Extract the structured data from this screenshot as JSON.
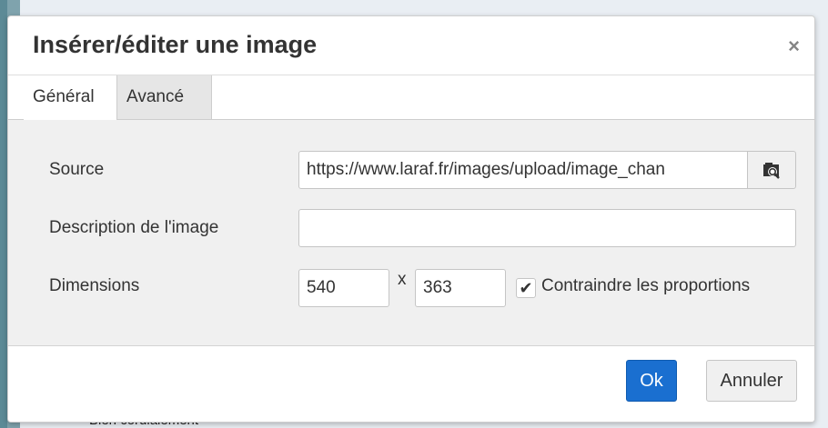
{
  "background": {
    "visible_text": "Bien cordialement"
  },
  "dialog": {
    "title": "Insérer/éditer une image",
    "close_glyph": "×",
    "tabs": [
      {
        "label": "Général",
        "active": true
      },
      {
        "label": "Avancé",
        "active": false
      }
    ],
    "fields": {
      "source_label": "Source",
      "source_value": "https://www.laraf.fr/images/upload/image_chan",
      "description_label": "Description de l'image",
      "description_value": "",
      "dimensions_label": "Dimensions",
      "width_value": "540",
      "dimension_separator": "x",
      "height_value": "363",
      "constrain_checked": true,
      "constrain_label": "Contraindre les proportions"
    },
    "buttons": {
      "ok_label": "Ok",
      "cancel_label": "Annuler"
    }
  },
  "colors": {
    "primary_button": "#1a6fd0",
    "body_background": "#f0f0f0"
  },
  "icons": {
    "browse": "browse-image-icon",
    "check": "checkmark-icon",
    "close": "close-icon"
  }
}
